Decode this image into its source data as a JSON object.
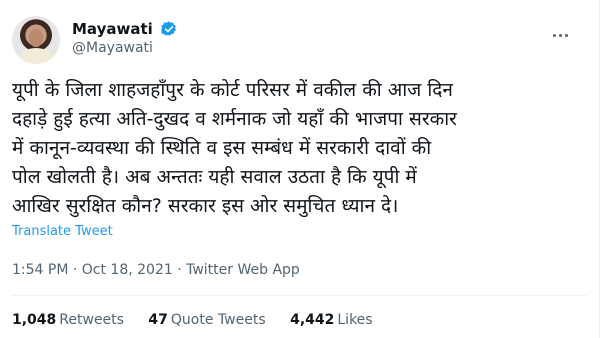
{
  "author": {
    "name": "Mayawati",
    "handle": "@Mayawati"
  },
  "tweet": {
    "text": "यूपी के जिला शाहजहाँपुर के कोर्ट परिसर में वकील की आज दिन\nदहाड़े हुई हत्या अति-दुखद व शर्मनाक जो यहाँ की भाजपा सरकार\nमें कानून-व्यवस्था की स्थिति व इस सम्बंध में सरकारी दावों की\nपोल खोलती है। अब अन्ततः यही सवाल उठता है कि यूपी में\nआखिर सुरक्षित कौन? सरकार इस ओर समुचित ध्यान दे।",
    "translate_label": "Translate Tweet",
    "timestamp": "1:54 PM · Oct 18, 2021 · Twitter Web App"
  },
  "stats": {
    "retweets_count": "1,048",
    "retweets_label": "Retweets",
    "quotes_count": "47",
    "quotes_label": "Quote Tweets",
    "likes_count": "4,442",
    "likes_label": "Likes"
  },
  "colors": {
    "accent": "#1d9bf0",
    "text": "#0f1419",
    "secondary": "#536471"
  },
  "icons": {
    "verified": "verified-badge-icon",
    "more": "more-options-icon"
  }
}
